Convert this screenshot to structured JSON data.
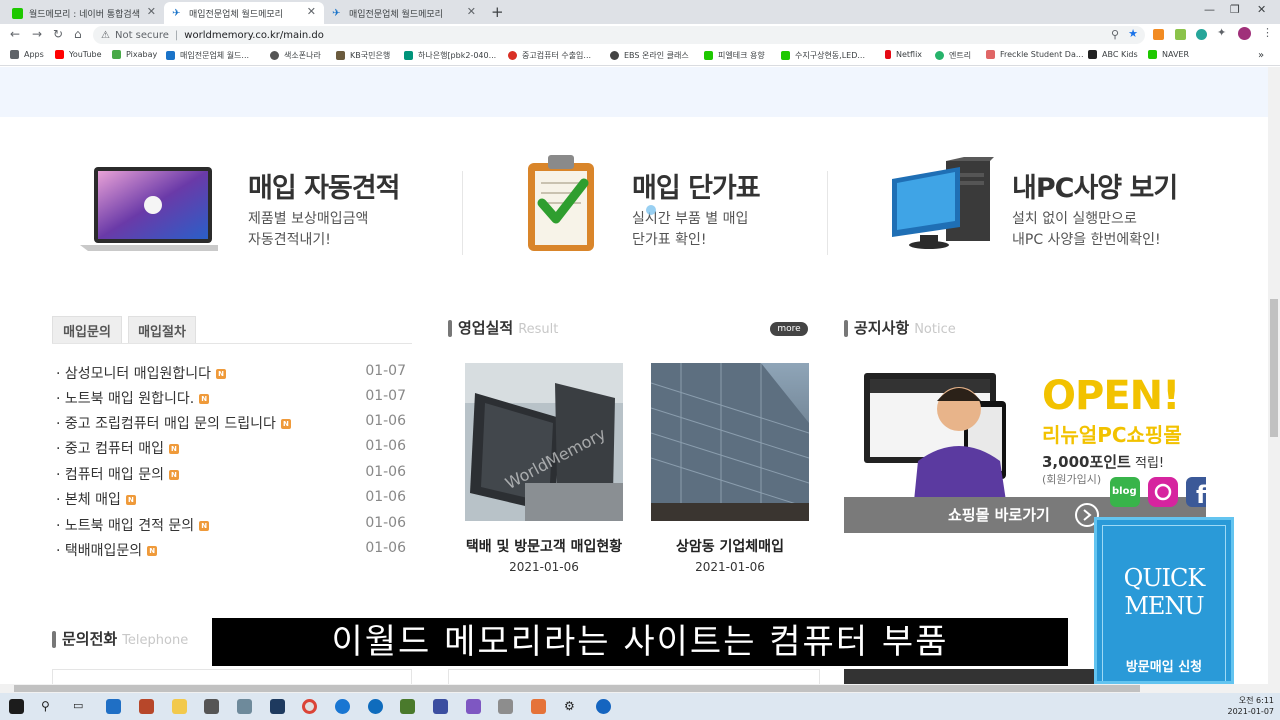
{
  "browser": {
    "tabs": [
      {
        "title": "월드메모리 : 네이버 통합검색",
        "active": false,
        "icon": "naver-icon"
      },
      {
        "title": "매입전문업체 월드메모리",
        "active": true,
        "icon": "worldmemory-icon"
      },
      {
        "title": "매입전문업체 월드메모리",
        "active": false,
        "icon": "worldmemory-icon"
      }
    ],
    "new_tab_label": "+",
    "security_label": "Not secure",
    "url": "worldmemory.co.kr/main.do",
    "bookmarks": [
      {
        "label": "Apps",
        "color": "#5f6368"
      },
      {
        "label": "YouTube",
        "color": "#ff0000"
      },
      {
        "label": "Pixabay",
        "color": "#48a947"
      },
      {
        "label": "매입전문업체 월드...",
        "color": "#1a73c8"
      },
      {
        "label": "색소폰나라",
        "color": "#555555"
      },
      {
        "label": "KB국민은행",
        "color": "#6b5b3e"
      },
      {
        "label": "하나은행[pbk2-040...",
        "color": "#00947a"
      },
      {
        "label": "중고컴퓨터 수출입...",
        "color": "#d93025"
      },
      {
        "label": "EBS 온라인 클래스",
        "color": "#444444"
      },
      {
        "label": "피엘테크 용향",
        "color": "#1ec800"
      },
      {
        "label": "수지구상현동,LED...",
        "color": "#1ec800"
      },
      {
        "label": "Netflix",
        "color": "#e50914"
      },
      {
        "label": "엔트리",
        "color": "#27b36b"
      },
      {
        "label": "Freckle Student Da...",
        "color": "#e06666"
      },
      {
        "label": "ABC Kids",
        "color": "#222222"
      },
      {
        "label": "NAVER",
        "color": "#1ec800"
      }
    ]
  },
  "features": [
    {
      "title": "매입 자동견적",
      "desc1": "제품별 보상매입금액",
      "desc2": "자동견적내기!",
      "icon": "laptop-icon"
    },
    {
      "title": "매입 단가표",
      "desc1": "실시간 부품 별 매입",
      "desc2": "단가표 확인!",
      "icon": "clipboard-check-icon"
    },
    {
      "title": "내PC사양 보기",
      "desc1": "설치 없이 실행만으로",
      "desc2": "내PC 사양을 한번에확인!",
      "icon": "desktop-pc-icon"
    }
  ],
  "inquiry": {
    "tabs": [
      "매입문의",
      "매입절차"
    ],
    "new_badge": "N",
    "items": [
      {
        "title": "· 삼성모니터 매입원합니다",
        "date": "01-07"
      },
      {
        "title": "· 노트북 매입 원합니다.",
        "date": "01-07"
      },
      {
        "title": "· 중고 조립컴퓨터 매입 문의 드립니다",
        "date": "01-06"
      },
      {
        "title": "· 중고 컴퓨터 매입",
        "date": "01-06"
      },
      {
        "title": "· 컴퓨터 매입 문의",
        "date": "01-06"
      },
      {
        "title": "· 본체 매입",
        "date": "01-06"
      },
      {
        "title": "· 노트북 매입 견적 문의",
        "date": "01-06"
      },
      {
        "title": "· 택배매입문의",
        "date": "01-06"
      }
    ]
  },
  "results": {
    "title": "영업실적",
    "sub": "Result",
    "more": "more",
    "items": [
      {
        "caption": "택배 및 방문고객 매입현황",
        "date": "2021-01-06",
        "watermark": "WorldMemory"
      },
      {
        "caption": "상암동 기업체매입",
        "date": "2021-01-06"
      }
    ]
  },
  "notice": {
    "title": "공지사항",
    "sub": "Notice",
    "banner": {
      "open": "OPEN!",
      "shop": "리뉴얼PC쇼핑몰",
      "points": "3,000포인트",
      "points_suffix": " 적립!",
      "member": "(회원가입시)",
      "cta": "쇼핑몰 바로가기",
      "blog": "blog"
    }
  },
  "phone_section": {
    "title": "문의전화",
    "sub": "Telephone"
  },
  "quick_menu": {
    "line1": "QUICK",
    "line2": "MENU",
    "button": "방문매입 신청"
  },
  "subtitle": "이월드 메모리라는 사이트는 컴퓨터 부품",
  "taskbar": {
    "time": "오전 6:11",
    "date": "2021-01-07"
  }
}
